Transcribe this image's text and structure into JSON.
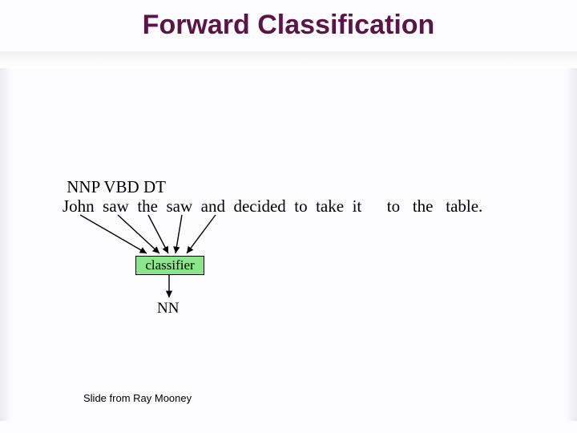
{
  "title": "Forward Classification",
  "tags_line": " NNP VBD DT",
  "sentence_line": "John  saw  the  saw  and  decided  to  take  it      to   the   table.",
  "classifier_label": "classifier",
  "output_tag": "NN",
  "footer": "Slide from Ray Mooney"
}
